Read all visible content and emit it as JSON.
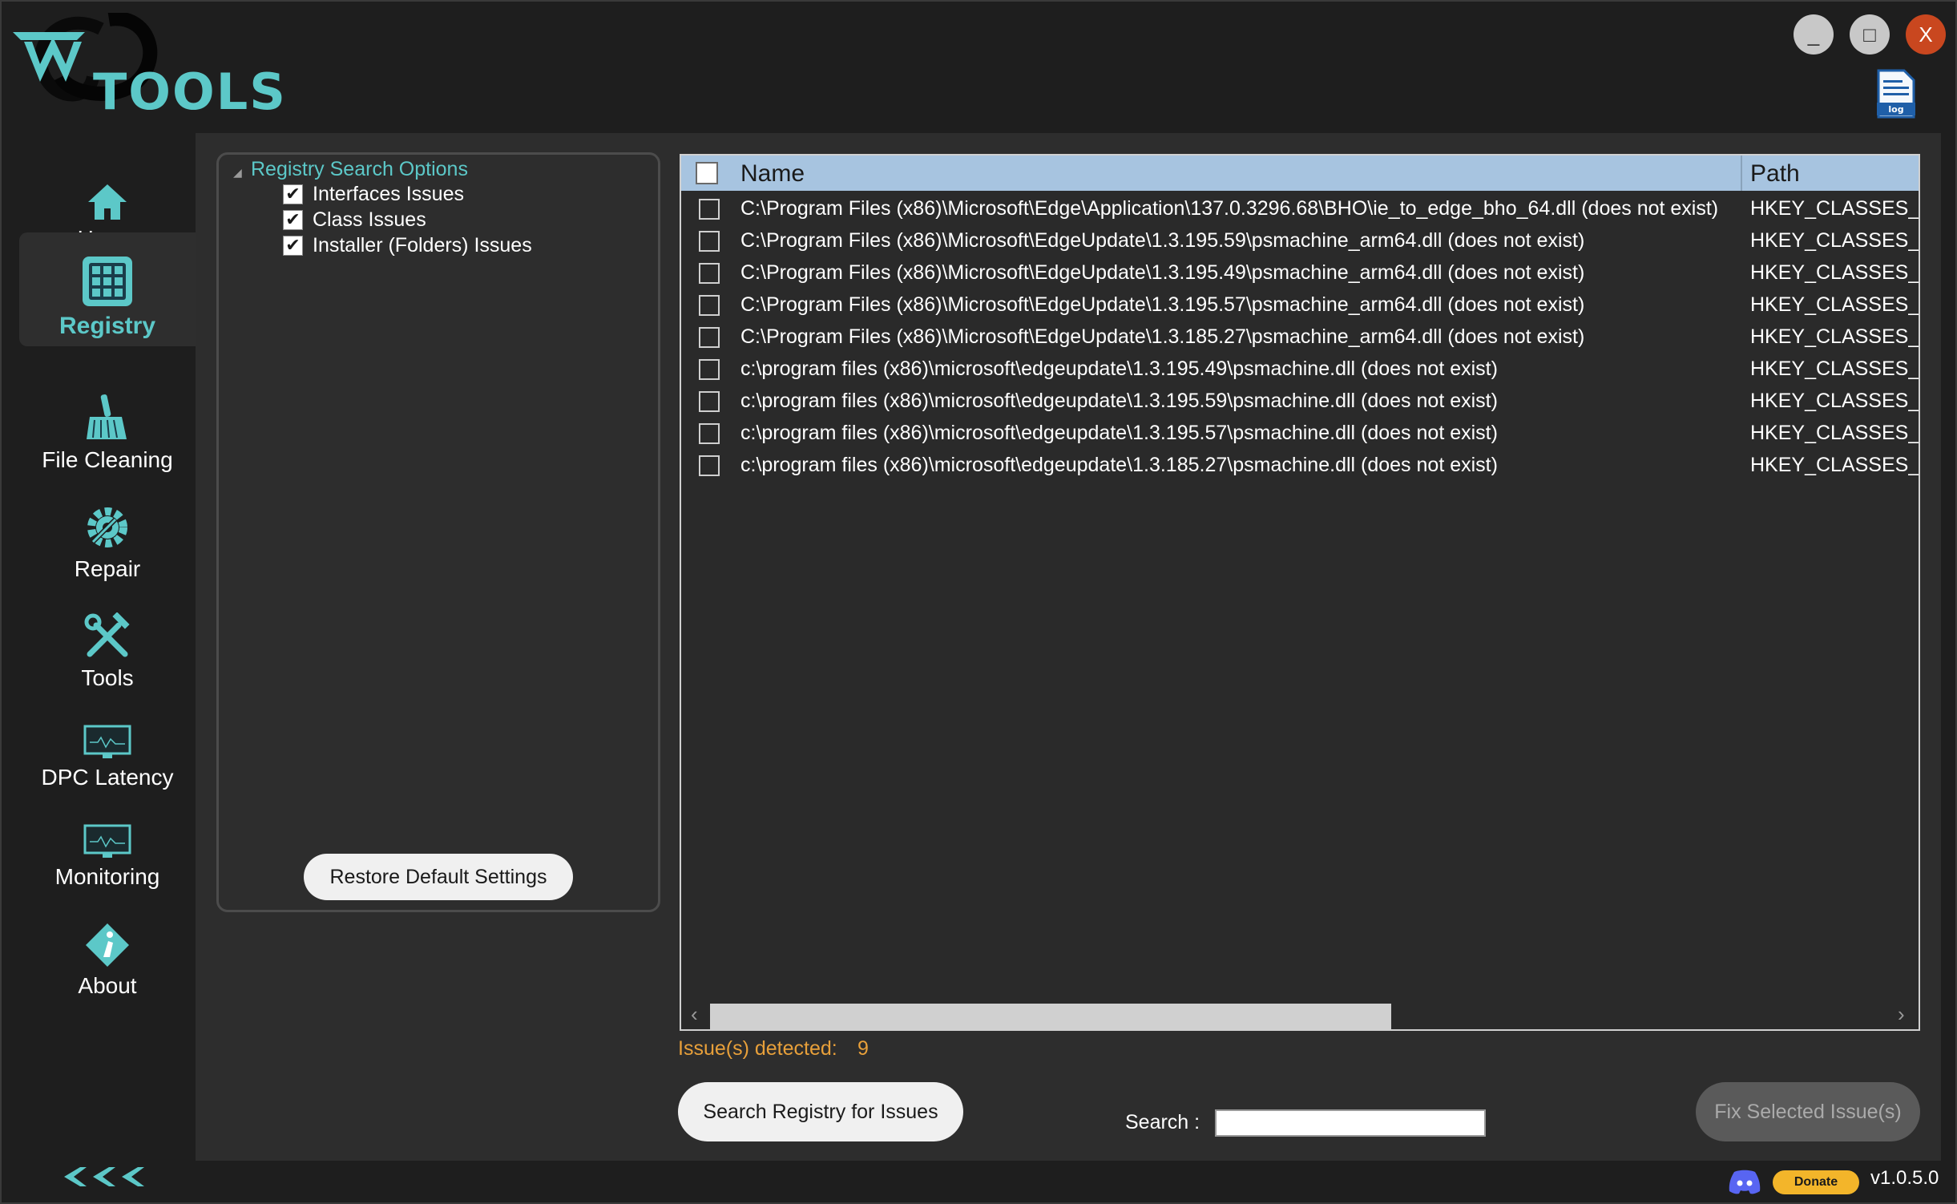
{
  "app": {
    "logo_text": "TOOLS",
    "accent_color": "#5cc8c8",
    "version": "v1.0.5.0"
  },
  "window_controls": {
    "minimize": "_",
    "maximize": "□",
    "close": "X"
  },
  "log_icon_label": "log",
  "sidebar": {
    "items": [
      {
        "label": "Home",
        "icon": "home-icon"
      },
      {
        "label": "Registry",
        "icon": "registry-icon",
        "active": true
      },
      {
        "label": "File Cleaning",
        "icon": "broom-icon"
      },
      {
        "label": "Repair",
        "icon": "gear-icon"
      },
      {
        "label": "Tools",
        "icon": "tools-icon"
      },
      {
        "label": "DPC Latency",
        "icon": "monitor-icon"
      },
      {
        "label": "Monitoring",
        "icon": "monitor-icon"
      },
      {
        "label": "About",
        "icon": "info-icon"
      }
    ],
    "collapse_label": "<<<"
  },
  "options": {
    "title": "Registry Search Options",
    "items": [
      {
        "label": "Interfaces Issues",
        "checked": true
      },
      {
        "label": "Class Issues",
        "checked": true
      },
      {
        "label": "Installer (Folders) Issues",
        "checked": true
      }
    ],
    "restore_button": "Restore Default Settings"
  },
  "results": {
    "columns": {
      "name": "Name",
      "path": "Path"
    },
    "rows": [
      {
        "name": "C:\\Program Files (x86)\\Microsoft\\Edge\\Application\\137.0.3296.68\\BHO\\ie_to_edge_bho_64.dll (does not exist)",
        "path": "HKEY_CLASSES_RC"
      },
      {
        "name": "C:\\Program Files (x86)\\Microsoft\\EdgeUpdate\\1.3.195.59\\psmachine_arm64.dll (does not exist)",
        "path": "HKEY_CLASSES_RC"
      },
      {
        "name": "C:\\Program Files (x86)\\Microsoft\\EdgeUpdate\\1.3.195.49\\psmachine_arm64.dll (does not exist)",
        "path": "HKEY_CLASSES_RC"
      },
      {
        "name": "C:\\Program Files (x86)\\Microsoft\\EdgeUpdate\\1.3.195.57\\psmachine_arm64.dll (does not exist)",
        "path": "HKEY_CLASSES_RC"
      },
      {
        "name": "C:\\Program Files (x86)\\Microsoft\\EdgeUpdate\\1.3.185.27\\psmachine_arm64.dll (does not exist)",
        "path": "HKEY_CLASSES_RC"
      },
      {
        "name": "c:\\program files (x86)\\microsoft\\edgeupdate\\1.3.195.49\\psmachine.dll (does not exist)",
        "path": "HKEY_CLASSES_RC"
      },
      {
        "name": "c:\\program files (x86)\\microsoft\\edgeupdate\\1.3.195.59\\psmachine.dll (does not exist)",
        "path": "HKEY_CLASSES_RC"
      },
      {
        "name": "c:\\program files (x86)\\microsoft\\edgeupdate\\1.3.195.57\\psmachine.dll (does not exist)",
        "path": "HKEY_CLASSES_RC"
      },
      {
        "name": "c:\\program files (x86)\\microsoft\\edgeupdate\\1.3.185.27\\psmachine.dll (does not exist)",
        "path": "HKEY_CLASSES_RC"
      }
    ],
    "scroll_left": "‹",
    "scroll_right": "›"
  },
  "status": {
    "issues_label": "Issue(s) detected:",
    "issues_count": "9",
    "status_color": "#e8a03a"
  },
  "actions": {
    "search_button": "Search Registry for Issues",
    "search_label": "Search :",
    "search_value": "",
    "fix_button": "Fix Selected Issue(s)"
  },
  "footer": {
    "donate_label": "Donate"
  }
}
